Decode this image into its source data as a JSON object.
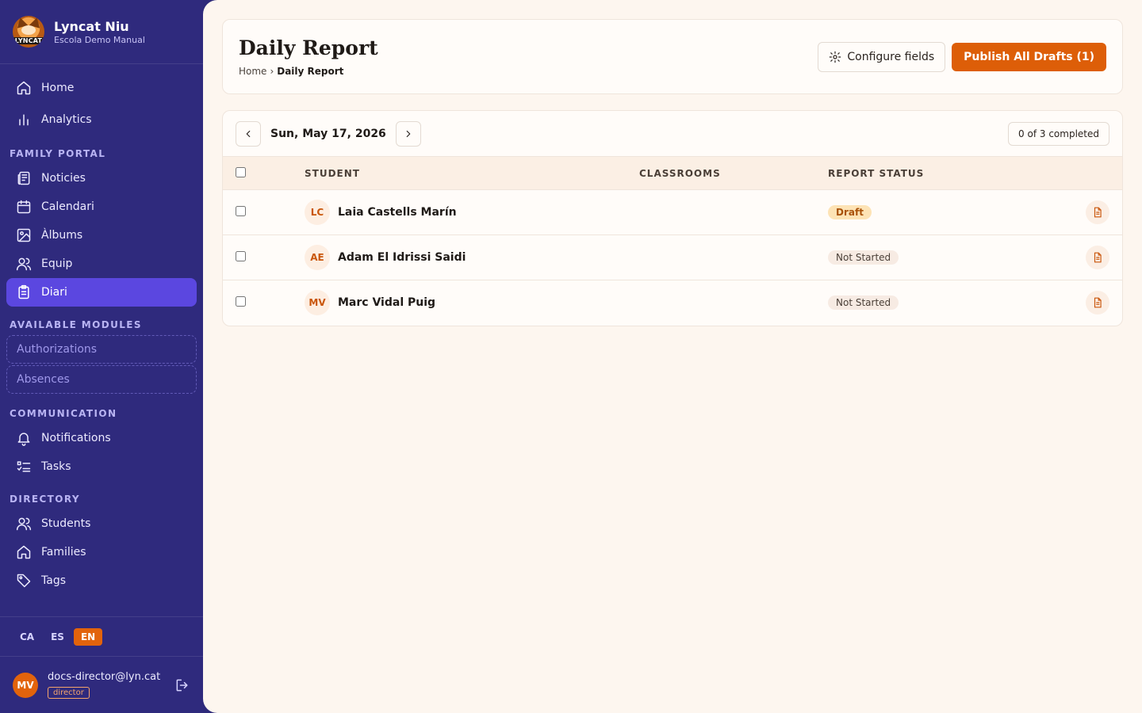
{
  "app": {
    "name": "Lyncat Niu",
    "school": "Escola Demo Manual",
    "logo_text": "LYNCAT"
  },
  "sidebar": {
    "main_items": [
      {
        "label": "Home",
        "icon": "home-icon"
      },
      {
        "label": "Analytics",
        "icon": "bar-chart-icon"
      }
    ],
    "family_portal": {
      "label": "FAMILY PORTAL",
      "items": [
        {
          "label": "Noticies",
          "icon": "newspaper-icon"
        },
        {
          "label": "Calendari",
          "icon": "calendar-icon"
        },
        {
          "label": "Àlbums",
          "icon": "image-icon"
        },
        {
          "label": "Equip",
          "icon": "users-icon"
        },
        {
          "label": "Diari",
          "icon": "clipboard-icon",
          "active": true
        }
      ]
    },
    "available_modules": {
      "label": "AVAILABLE MODULES",
      "items": [
        {
          "label": "Authorizations"
        },
        {
          "label": "Absences"
        }
      ]
    },
    "communication": {
      "label": "COMMUNICATION",
      "items": [
        {
          "label": "Notifications",
          "icon": "bell-icon"
        },
        {
          "label": "Tasks",
          "icon": "checklist-icon"
        }
      ]
    },
    "directory": {
      "label": "DIRECTORY",
      "items": [
        {
          "label": "Students",
          "icon": "users-icon"
        },
        {
          "label": "Families",
          "icon": "home-icon"
        },
        {
          "label": "Tags",
          "icon": "tag-icon"
        }
      ]
    },
    "languages": [
      {
        "code": "CA",
        "active": false
      },
      {
        "code": "ES",
        "active": false
      },
      {
        "code": "EN",
        "active": true
      }
    ],
    "user": {
      "initials": "MV",
      "email": "docs-director@lyn.cat",
      "role": "director"
    }
  },
  "header": {
    "title": "Daily Report",
    "breadcrumb": [
      "Home",
      "Daily Report"
    ],
    "breadcrumb_sep": "›",
    "configure_label": "Configure fields",
    "publish_label": "Publish All Drafts (1)"
  },
  "report": {
    "date": "Sun, May 17, 2026",
    "completed": "0 of 3 completed",
    "columns": {
      "student": "STUDENT",
      "classrooms": "CLASSROOMS",
      "status": "REPORT STATUS"
    },
    "rows": [
      {
        "initials": "LC",
        "name": "Laia Castells Marín",
        "classrooms": "",
        "status": "Draft",
        "status_kind": "draft"
      },
      {
        "initials": "AE",
        "name": "Adam El Idrissi Saidi",
        "classrooms": "",
        "status": "Not Started",
        "status_kind": "notstarted"
      },
      {
        "initials": "MV",
        "name": "Marc Vidal Puig",
        "classrooms": "",
        "status": "Not Started",
        "status_kind": "notstarted"
      }
    ]
  },
  "colors": {
    "sidebar_bg": "#2f2a7d",
    "active_item": "#5b47e0",
    "accent": "#dd5e08",
    "page_bg": "#fdf6ef"
  }
}
